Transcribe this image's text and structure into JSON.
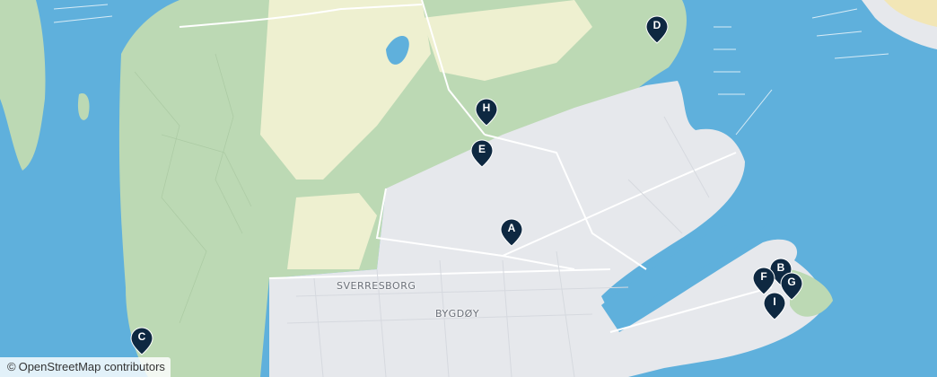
{
  "map": {
    "labels": {
      "sverresborg": "SVERRESBORG",
      "bygdoy": "BYGDØY"
    },
    "markers": [
      {
        "id": "A",
        "letter": "A"
      },
      {
        "id": "B",
        "letter": "B"
      },
      {
        "id": "C",
        "letter": "C"
      },
      {
        "id": "D",
        "letter": "D"
      },
      {
        "id": "E",
        "letter": "E"
      },
      {
        "id": "F",
        "letter": "F"
      },
      {
        "id": "G",
        "letter": "G"
      },
      {
        "id": "H",
        "letter": "H"
      },
      {
        "id": "I",
        "letter": "I"
      }
    ],
    "attribution": {
      "symbol": "©",
      "text": "OpenStreetMap contributors"
    },
    "colors": {
      "water": "#5fb0dc",
      "forest": "#bcd9b4",
      "field": "#eef0d0",
      "urban": "#e6e8ec",
      "marker": "#0e2841"
    }
  }
}
